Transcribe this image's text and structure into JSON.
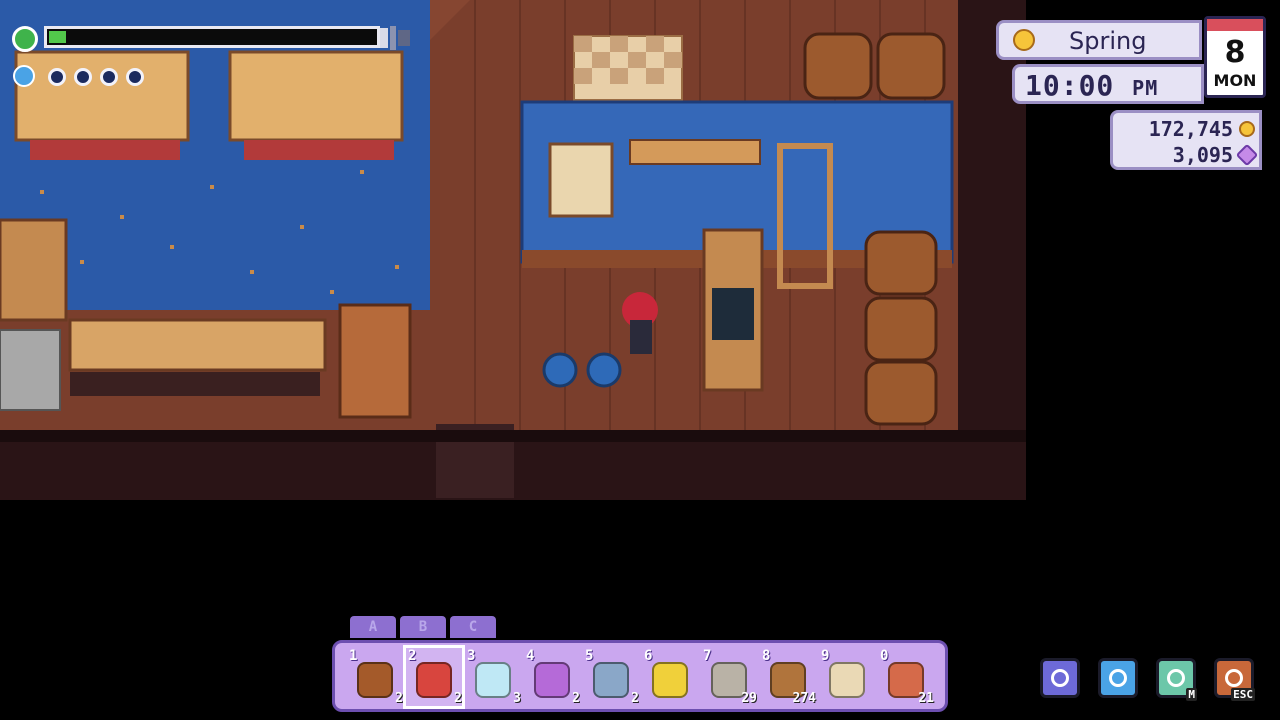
{
  "hud": {
    "stamina_fraction": 0.05,
    "mana_orbs_total": 4,
    "season": "Spring",
    "time": "10:00",
    "ampm": "PM",
    "day": "8",
    "weekday": "MON",
    "gold": "172,745",
    "essence": "3,095"
  },
  "hotbar": {
    "tabs": [
      "A",
      "B",
      "C"
    ],
    "selected_index": 1,
    "slots": [
      {
        "num": "1",
        "icon": "wood-stump-icon",
        "count": "2",
        "color": "#a45a2a"
      },
      {
        "num": "2",
        "icon": "red-feather-icon",
        "count": "2",
        "color": "#d8453e"
      },
      {
        "num": "3",
        "icon": "diamond-icon",
        "count": "3",
        "color": "#bfe8f5"
      },
      {
        "num": "4",
        "icon": "purple-mushroom-icon",
        "count": "2",
        "color": "#b56ad8"
      },
      {
        "num": "5",
        "icon": "fish-icon",
        "count": "2",
        "color": "#8aa7c8"
      },
      {
        "num": "6",
        "icon": "yellow-flower-icon",
        "count": "",
        "color": "#f0d03a"
      },
      {
        "num": "7",
        "icon": "stone-icon",
        "count": "29",
        "color": "#b9b2a6"
      },
      {
        "num": "8",
        "icon": "root-icon",
        "count": "274",
        "color": "#b0743c"
      },
      {
        "num": "9",
        "icon": "scroll-icon",
        "count": "",
        "color": "#ead9b5"
      },
      {
        "num": "0",
        "icon": "pie-icon",
        "count": "21",
        "color": "#d56a4a"
      }
    ]
  },
  "menu_buttons": [
    {
      "icon": "horseshoe-icon",
      "key": "",
      "color": "#6d6ad8"
    },
    {
      "icon": "water-drop-icon",
      "key": "",
      "color": "#4aa3e6"
    },
    {
      "icon": "map-icon",
      "key": "M",
      "color": "#6cc7a9"
    },
    {
      "icon": "journal-icon",
      "key": "ESC",
      "color": "#c8683a"
    }
  ],
  "colors": {
    "floor_wood": "#7a3e2c",
    "rug_blue": "#2b5aa8",
    "wall_dark": "#3b1e1f",
    "counter_blue": "#3568b8"
  }
}
